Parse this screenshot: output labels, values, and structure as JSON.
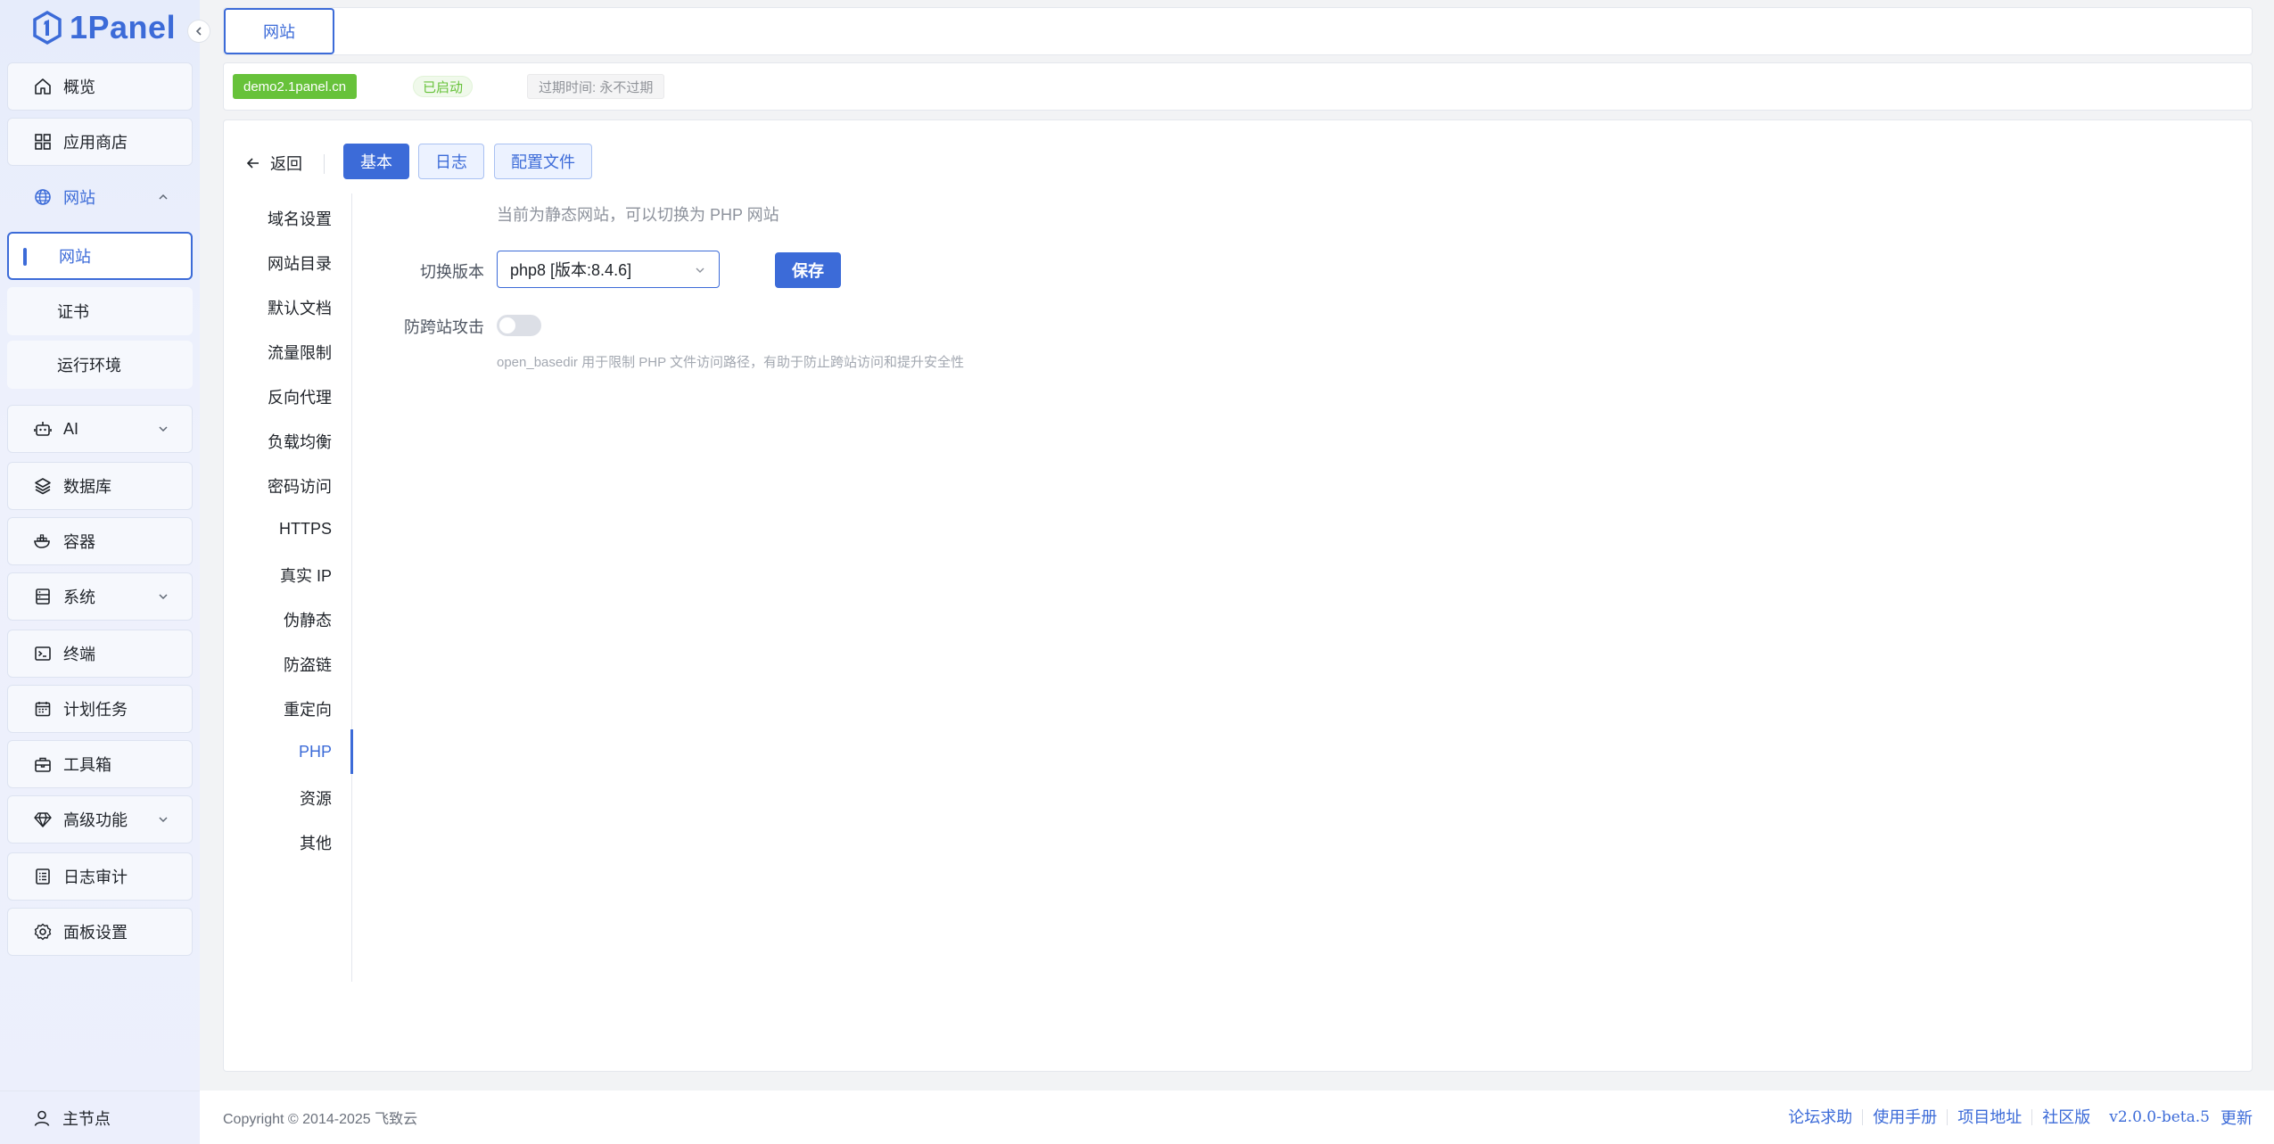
{
  "app": {
    "logo_text": "1Panel"
  },
  "sidebar": {
    "items": [
      {
        "label": "概览",
        "icon": "home-icon"
      },
      {
        "label": "应用商店",
        "icon": "grid-icon"
      },
      {
        "label": "网站",
        "icon": "globe-icon",
        "expanded": true,
        "children": [
          {
            "label": "网站",
            "active": true
          },
          {
            "label": "证书"
          },
          {
            "label": "运行环境"
          }
        ]
      },
      {
        "label": "AI",
        "icon": "robot-icon",
        "expandable": true
      },
      {
        "label": "数据库",
        "icon": "layers-icon"
      },
      {
        "label": "容器",
        "icon": "docker-icon"
      },
      {
        "label": "系统",
        "icon": "server-icon",
        "expandable": true
      },
      {
        "label": "终端",
        "icon": "terminal-icon"
      },
      {
        "label": "计划任务",
        "icon": "calendar-icon"
      },
      {
        "label": "工具箱",
        "icon": "toolbox-icon"
      },
      {
        "label": "高级功能",
        "icon": "diamond-icon",
        "expandable": true
      },
      {
        "label": "日志审计",
        "icon": "log-icon"
      },
      {
        "label": "面板设置",
        "icon": "gear-icon"
      }
    ],
    "node": {
      "label": "主节点",
      "icon": "user-icon"
    }
  },
  "tabbar": {
    "tab": "网站"
  },
  "site_info": {
    "domain": "demo2.1panel.cn",
    "status": "已启动",
    "expire": "过期时间: 永不过期"
  },
  "toolbar": {
    "back": "返回",
    "tabs": [
      "基本",
      "日志",
      "配置文件"
    ],
    "active_tab": "基本"
  },
  "subnav": {
    "items": [
      "域名设置",
      "网站目录",
      "默认文档",
      "流量限制",
      "反向代理",
      "负载均衡",
      "密码访问",
      "HTTPS",
      "真实 IP",
      "伪静态",
      "防盗链",
      "重定向",
      "PHP",
      "资源",
      "其他"
    ],
    "active": "PHP"
  },
  "php_form": {
    "hint": "当前为静态网站，可以切换为 PHP 网站",
    "version_label": "切换版本",
    "version_value": "php8 [版本:8.4.6]",
    "save": "保存",
    "cross_site_label": "防跨站攻击",
    "cross_site_enabled": false,
    "basedir_hint": "open_basedir 用于限制 PHP 文件访问路径，有助于防止跨站访问和提升安全性"
  },
  "footer": {
    "copyright": "Copyright © 2014-2025 飞致云",
    "links": [
      "论坛求助",
      "使用手册",
      "项目地址",
      "社区版"
    ],
    "version": "v2.0.0-beta.5",
    "update": "更新"
  },
  "colors": {
    "accent": "#3c6bd8",
    "success": "#67c23a"
  }
}
